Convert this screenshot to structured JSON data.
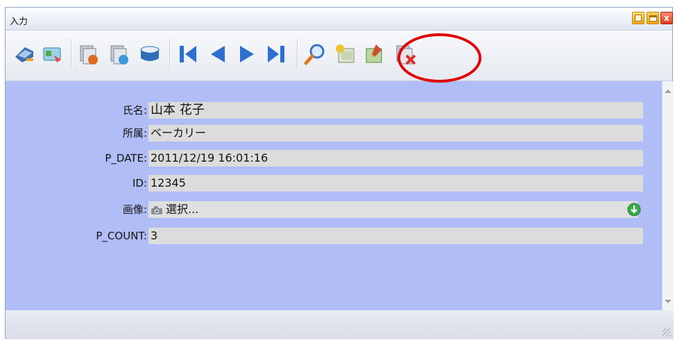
{
  "window": {
    "title": "入力"
  },
  "toolbar": {
    "buttons": [
      {
        "icon": "print-icon"
      },
      {
        "icon": "card-icon"
      },
      {
        "icon": "copy-record-icon"
      },
      {
        "icon": "refresh-record-icon"
      },
      {
        "icon": "database-icon"
      },
      {
        "icon": "first-record-icon"
      },
      {
        "icon": "previous-record-icon"
      },
      {
        "icon": "next-record-icon"
      },
      {
        "icon": "last-record-icon"
      },
      {
        "icon": "search-icon"
      },
      {
        "icon": "new-record-icon"
      },
      {
        "icon": "edit-record-icon"
      },
      {
        "icon": "delete-record-icon"
      }
    ]
  },
  "form": {
    "fields": [
      {
        "label": "氏名",
        "value": "山本  花子"
      },
      {
        "label": "所属",
        "value": "ベーカリー"
      },
      {
        "label": "P_DATE",
        "value": "2011/12/19 16:01:16"
      },
      {
        "label": "ID",
        "value": "12345"
      },
      {
        "label": "画像",
        "value": "選択..."
      },
      {
        "label": "P_COUNT",
        "value": "3"
      }
    ]
  },
  "colors": {
    "form_background": "#b0bdf6",
    "field_background": "#dcdcdc",
    "highlight": "#e00000"
  }
}
